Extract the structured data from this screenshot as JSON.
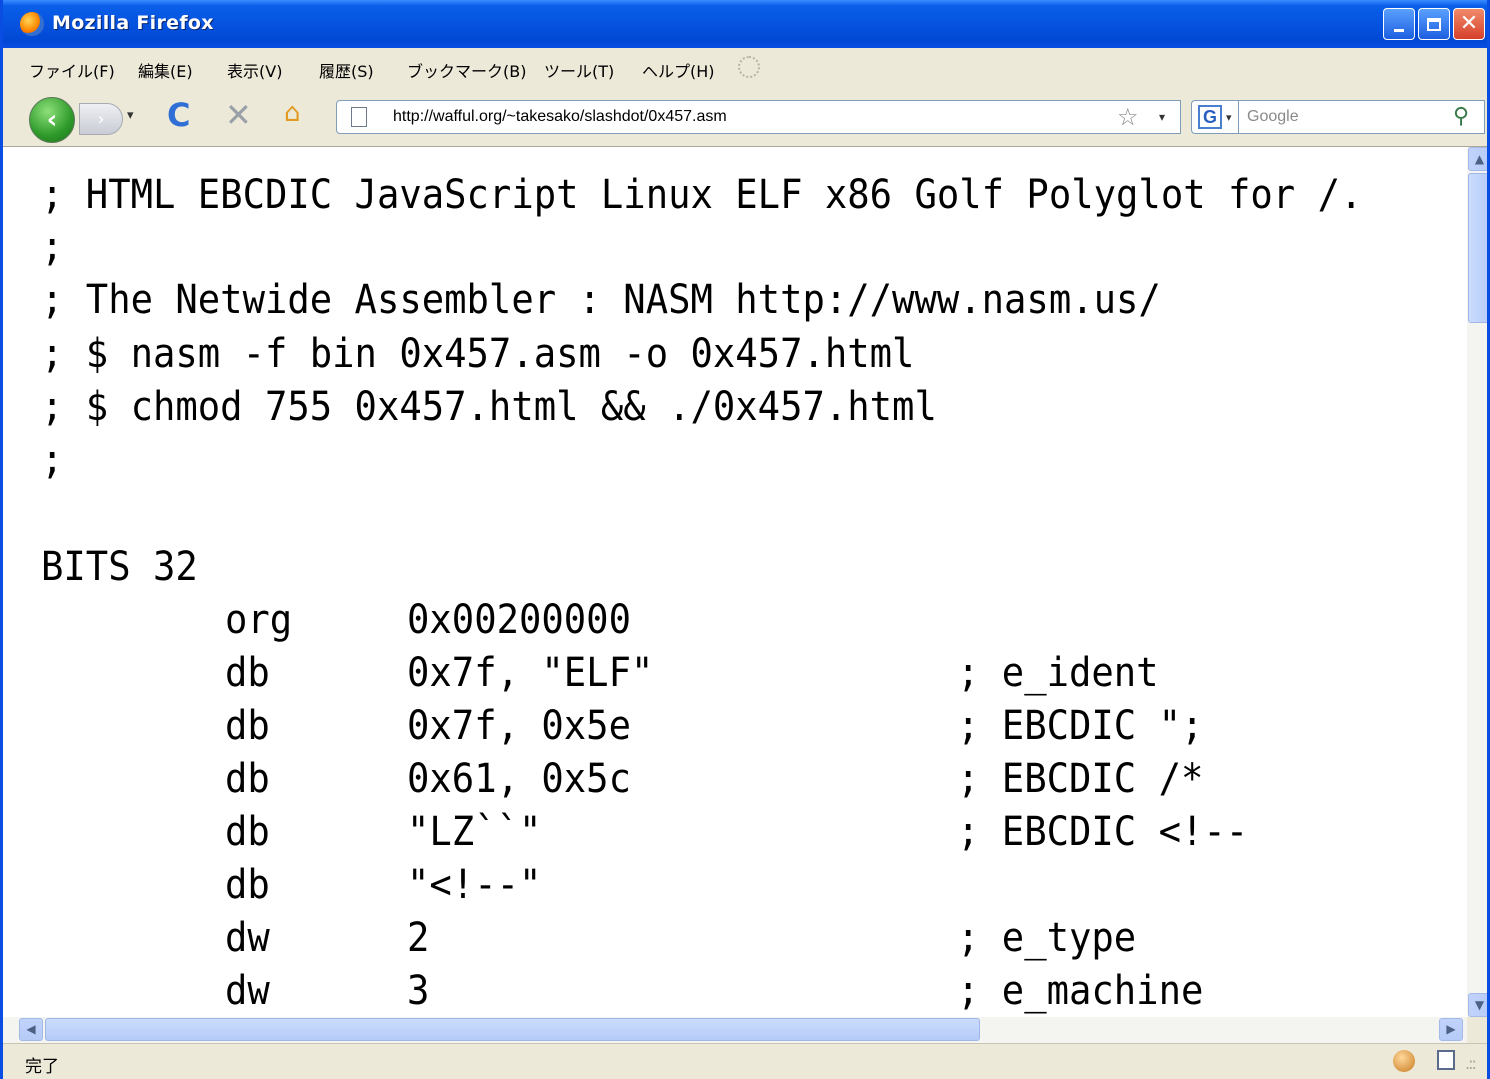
{
  "window": {
    "title": "Mozilla Firefox",
    "controls": {
      "minimize": "minimize",
      "maximize": "maximize",
      "close": "✕"
    }
  },
  "menu": {
    "items": [
      "ファイル(F)",
      "編集(E)",
      "表示(V)",
      "履歴(S)",
      "ブックマーク(B)",
      "ツール(T)",
      "ヘルプ(H)"
    ]
  },
  "nav": {
    "back": "‹",
    "forward": "›",
    "dropdown": "▾",
    "reload": "C",
    "stop": "✕",
    "home": "⌂",
    "url": "http://wafful.org/~takesako/slashdot/0x457.asm",
    "bookmark_star": "☆",
    "search_engine_letter": "G",
    "search_placeholder": "Google",
    "search_icon": "⚲"
  },
  "code": {
    "header": [
      "; HTML EBCDIC JavaScript Linux ELF x86 Golf Polyglot for /.",
      ";",
      "; The Netwide Assembler : NASM http://www.nasm.us/",
      "; $ nasm -f bin 0x457.asm -o 0x457.html",
      "; $ chmod 755 0x457.html && ./0x457.html",
      ";",
      "",
      "BITS 32"
    ],
    "rows": [
      {
        "op": "org",
        "arg": "0x00200000",
        "comment": ""
      },
      {
        "op": "db",
        "arg": "0x7f, \"ELF\"",
        "comment": "; e_ident"
      },
      {
        "op": "db",
        "arg": "0x7f, 0x5e",
        "comment": "; EBCDIC \";"
      },
      {
        "op": "db",
        "arg": "0x61, 0x5c",
        "comment": "; EBCDIC /*"
      },
      {
        "op": "db",
        "arg": "\"LZ``\"",
        "comment": "; EBCDIC <!--"
      },
      {
        "op": "db",
        "arg": "\"<!--\"",
        "comment": ""
      },
      {
        "op": "dw",
        "arg": "2",
        "comment": "; e_type"
      },
      {
        "op": "dw",
        "arg": "3",
        "comment": "; e_machine"
      }
    ]
  },
  "scrollbars": {
    "up": "▲",
    "down": "▼",
    "left": "◀",
    "right": "▶"
  },
  "status": {
    "text": "完了",
    "grip": ".::"
  }
}
